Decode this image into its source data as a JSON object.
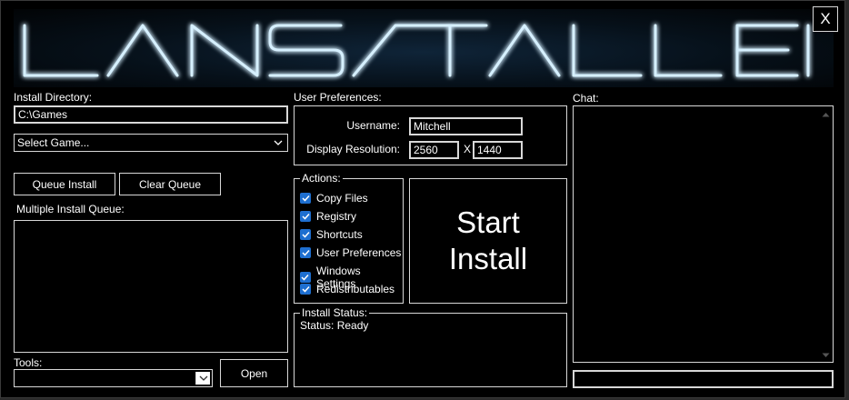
{
  "app": {
    "title": "LANSTALLER",
    "close_label": "X"
  },
  "left": {
    "install_dir_label": "Install Directory:",
    "install_dir_value": "C:\\Games",
    "game_select_value": "Select Game...",
    "queue_install_label": "Queue Install",
    "clear_queue_label": "Clear Queue",
    "queue_label": "Multiple Install Queue:",
    "tools_label": "Tools:",
    "tools_value": "",
    "open_label": "Open"
  },
  "prefs": {
    "label": "User Preferences:",
    "username_label": "Username:",
    "username_value": "Mitchell",
    "resolution_label": "Display Resolution:",
    "res_width": "2560",
    "res_sep": "X",
    "res_height": "1440"
  },
  "actions": {
    "label": "Actions:",
    "items": [
      {
        "label": "Copy Files",
        "checked": true
      },
      {
        "label": "Registry",
        "checked": true
      },
      {
        "label": "Shortcuts",
        "checked": true
      },
      {
        "label": "User Preferences",
        "checked": true
      },
      {
        "label": "Windows Settings",
        "checked": true
      },
      {
        "label": "Redistributables",
        "checked": true
      }
    ]
  },
  "start": {
    "line1": "Start",
    "line2": "Install"
  },
  "status": {
    "label": "Install Status:",
    "text": "Status: Ready"
  },
  "chat": {
    "label": "Chat:",
    "input_value": ""
  },
  "colors": {
    "background": "#000000",
    "border": "#d8d8d8",
    "check_accent": "#1e6fd0",
    "logo_glow": "#6fc3ff"
  }
}
